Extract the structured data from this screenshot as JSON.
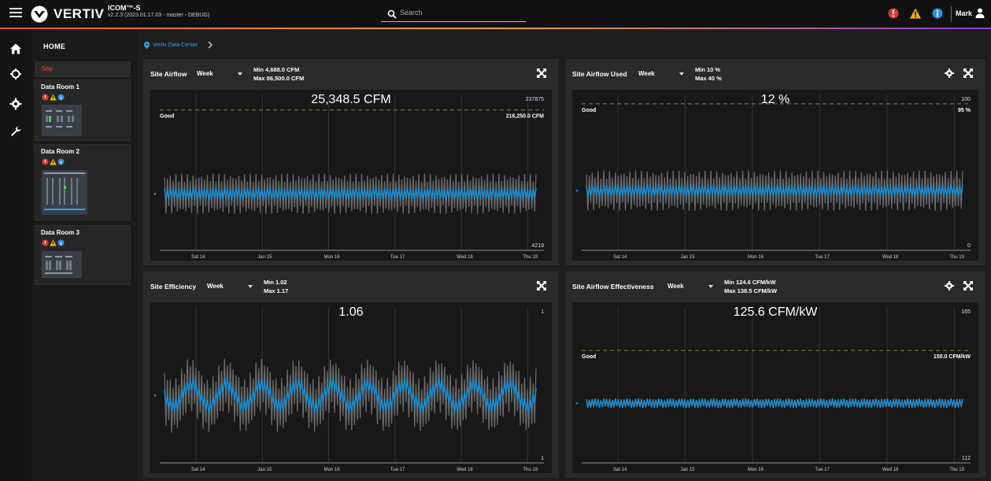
{
  "header": {
    "brand": "VERTIV",
    "app_name": "ICOM™-S",
    "app_version": "v2.2.3 (2023.01.17.03 - master - DEBUG)",
    "search_placeholder": "Search",
    "user_name": "Mark"
  },
  "sidebar": {
    "home_label": "HOME",
    "site_label": "Site",
    "rooms": [
      {
        "label": "Data Room 1"
      },
      {
        "label": "Data Room 2"
      },
      {
        "label": "Data Room 3"
      }
    ]
  },
  "breadcrumb": {
    "label": "Vertiv Data Center"
  },
  "colors": {
    "accent_blue": "#1f8ac9",
    "trace_gray": "#6e6e6e",
    "good_line": "#6b8e3a",
    "alert_red": "#d93a3a",
    "alert_yellow": "#f0b400",
    "info_blue": "#2f8fdc"
  },
  "panels": [
    {
      "title": "Site Airflow",
      "period": "Week",
      "min": "Min 4,688.0 CFM",
      "max": "Max 86,500.0 CFM",
      "current": "25,348.5 CFM",
      "y_top": "237875",
      "y_bottom": "4219",
      "good_label": "Good",
      "good_value": "216,250.0 CFM",
      "has_gear": false
    },
    {
      "title": "Site Airflow Used",
      "period": "Week",
      "min": "Min 10 %",
      "max": "Max 40 %",
      "current": "12 %",
      "y_top": "100",
      "y_bottom": "0",
      "good_label": "Good",
      "good_value": "95 %",
      "has_gear": true
    },
    {
      "title": "Site Efficiency",
      "period": "Week",
      "min": "Min 1.02",
      "max": "Max 1.17",
      "current": "1.06",
      "y_top": "1",
      "y_bottom": "1",
      "good_label": "",
      "good_value": "",
      "has_gear": false
    },
    {
      "title": "Site Airflow Effectiveness",
      "period": "Week",
      "min": "Min 124.6 CFM/kW",
      "max": "Max 138.5 CFM/kW",
      "current": "125.6 CFM/kW",
      "y_top": "165",
      "y_bottom": "112",
      "good_label": "Good",
      "good_value": "150.0 CFM/kW",
      "has_gear": true
    }
  ],
  "x_ticks": [
    "Sat 14",
    "Jan 15",
    "Mon 16",
    "Tue 17",
    "Wed 18",
    "Thu 19"
  ]
}
